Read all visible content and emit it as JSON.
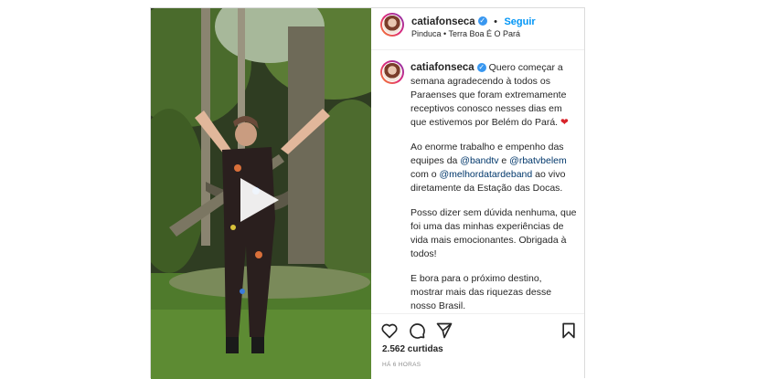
{
  "header": {
    "username": "catiafonseca",
    "follow_label": "Seguir",
    "separator": "•",
    "location": "Pinduca • Terra Boa É O Pará"
  },
  "caption": {
    "username": "catiafonseca",
    "p1": "Quero começar a semana agradecendo à todos os Paraenses que foram extremamente receptivos conosco nesses dias em que estivemos por Belém do Pará.",
    "p2_a": "Ao enorme trabalho e empenho das equipes da ",
    "mention1": "@bandtv",
    "p2_b": " e ",
    "mention2": "@rbatvbelem",
    "p2_c": " com o ",
    "mention3": "@melhordatardeband",
    "p2_d": " ao vivo diretamente da Estação das Docas.",
    "p3": "Posso dizer sem dúvida nenhuma, que foi uma das minhas experiências de vida mais emocionantes. Obrigada à todos!",
    "p4": "E bora para o próximo destino, mostrar mais das riquezas desse nosso Brasil."
  },
  "stats": {
    "likes": "2.562 curtidas",
    "time": "HÁ 6 HORAS"
  },
  "icons": {
    "heart": "heart-icon",
    "comment": "comment-icon",
    "share": "share-icon",
    "save": "bookmark-icon",
    "play": "play-icon",
    "verified": "verified-badge-icon"
  },
  "colors": {
    "accent": "#0095f6",
    "verified": "#3897f0",
    "mention": "#00376b",
    "heart_emoji": "#d8232a"
  }
}
